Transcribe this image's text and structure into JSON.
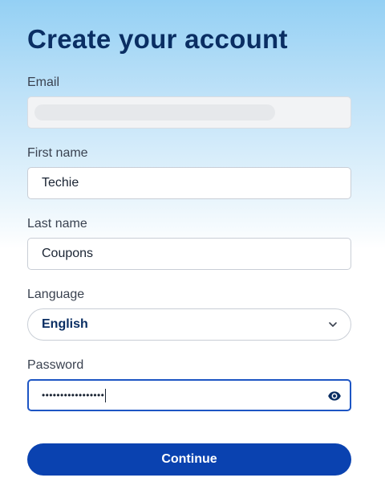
{
  "page": {
    "title": "Create your account"
  },
  "form": {
    "email": {
      "label": "Email",
      "value": ""
    },
    "first_name": {
      "label": "First name",
      "value": "Techie"
    },
    "last_name": {
      "label": "Last name",
      "value": "Coupons"
    },
    "language": {
      "label": "Language",
      "selected": "English"
    },
    "password": {
      "label": "Password",
      "masked_value": "•••••••••••••••••"
    }
  },
  "actions": {
    "continue_label": "Continue"
  },
  "icons": {
    "language_dropdown": "chevron-down-icon",
    "password_toggle": "eye-icon"
  },
  "colors": {
    "title": "#0a2e63",
    "primary_button": "#0a42b0",
    "focus_border": "#1d55c4"
  }
}
